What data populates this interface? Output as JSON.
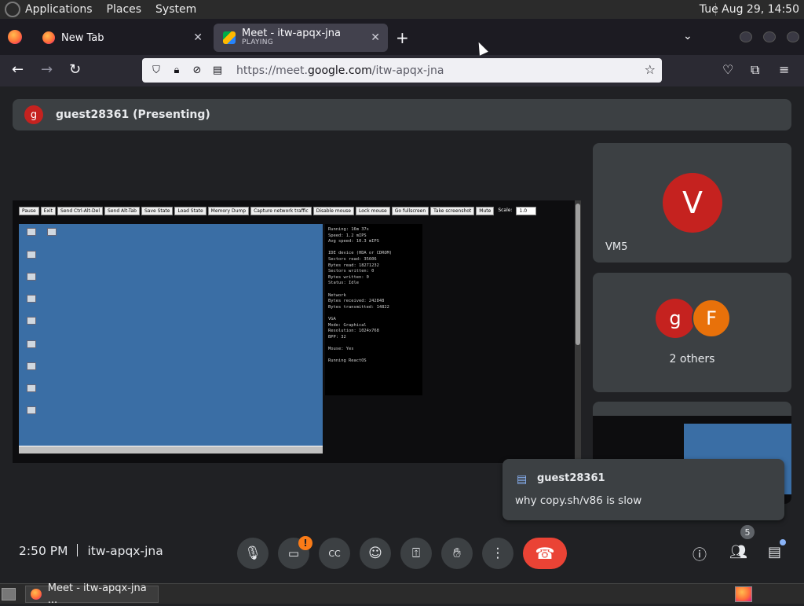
{
  "system_bar": {
    "menus": [
      "Applications",
      "Places",
      "System"
    ],
    "clock": "Tue Aug 29, 14:50"
  },
  "browser": {
    "tabs": [
      {
        "title": "New Tab",
        "subtitle": ""
      },
      {
        "title": "Meet - itw-apqx-jna",
        "subtitle": "PLAYING"
      }
    ],
    "url_prefix": "https://meet.",
    "url_domain": "google.com",
    "url_path": "/itw-apqx-jna"
  },
  "meet": {
    "presenter": {
      "initial": "g",
      "label": "guest28361 (Presenting)"
    },
    "participants": [
      {
        "initial": "V",
        "name": "VM5",
        "color": "#c5221f"
      }
    ],
    "group_tile": {
      "initials": [
        "g",
        "F"
      ],
      "caption": "2 others"
    },
    "chat_toast": {
      "sender": "guest28361",
      "message": "why copy.sh/v86 is slow"
    },
    "time": "2:50 PM",
    "meeting_code": "itw-apqx-jna",
    "camera_alert": "!",
    "people_count": "5"
  },
  "shared_screen": {
    "toolbar": [
      "Pause",
      "Exit",
      "Send Ctrl-Alt-Del",
      "Send Alt-Tab",
      "Save State",
      "Load State",
      "Memory Dump",
      "Capture network traffic",
      "Disable mouse",
      "Lock mouse",
      "Go fullscreen",
      "Take screenshot",
      "Mute"
    ],
    "scale_label": "Scale:",
    "scale_value": "1.0",
    "stats": "Running: 16m 37s\nSpeed: 1.2 mIPS\nAvg speed: 10.3 mIPS\n\nIDE device (HDA or CDROM)\nSectors read: 35606\nBytes read: 18271232\nSectors written: 0\nBytes written: 0\nStatus: Idle\n\nNetwork\nBytes received: 242848\nBytes transmitted: 14822\n\nVGA\nMode: Graphical\nResolution: 1024x768\nBPP: 32\n\nMouse: Yes\n\nRunning ReactOS"
  },
  "os_taskbar": {
    "task_label": "Meet - itw-apqx-jna ..."
  },
  "colors": {
    "meet_bg": "#202124",
    "tile_bg": "#3c4043",
    "end_call": "#ea4335",
    "alert": "#fa7b17"
  }
}
